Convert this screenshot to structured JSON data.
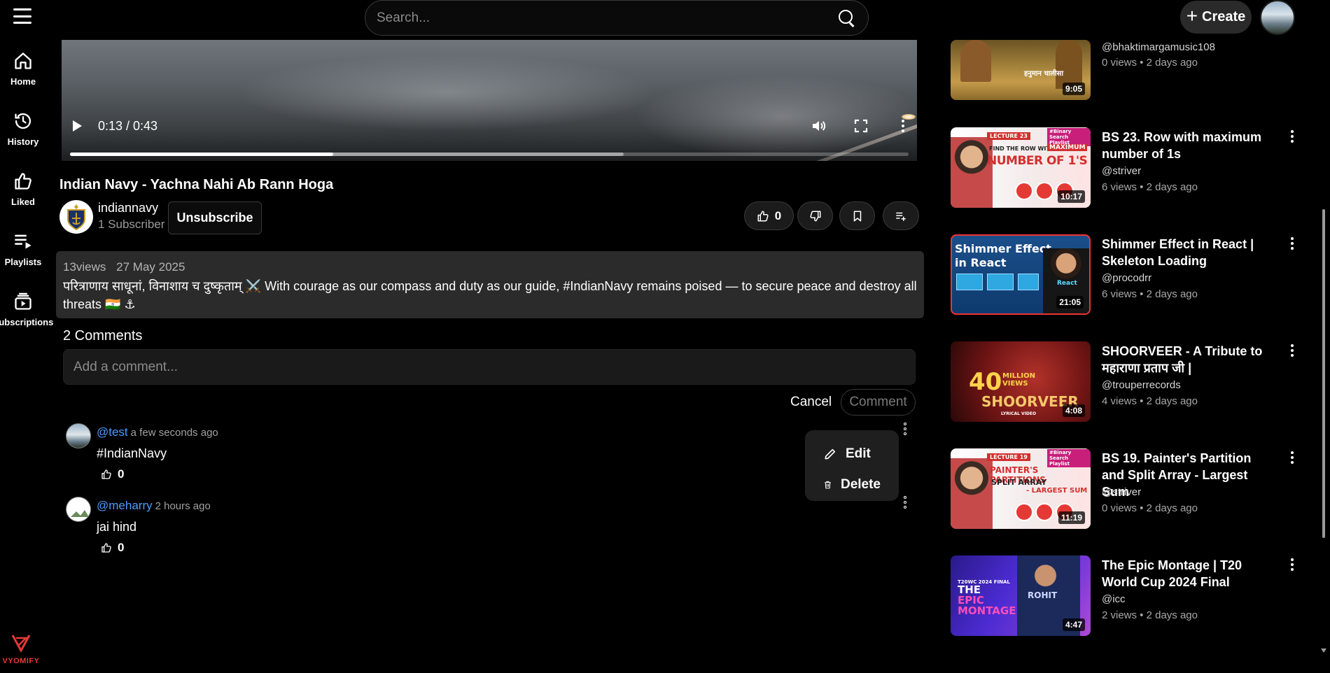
{
  "header": {
    "search_placeholder": "Search...",
    "create_label": "Create"
  },
  "sidebar": {
    "items": [
      {
        "label": "Home"
      },
      {
        "label": "History"
      },
      {
        "label": "Liked"
      },
      {
        "label": "Playlists"
      },
      {
        "label": "Subscriptions"
      }
    ],
    "brand": "VYOMIFY"
  },
  "player": {
    "time": "0:13 / 0:43",
    "played_fraction": 0.314,
    "buffered_fraction": 0.66
  },
  "video": {
    "title": "Indian Navy - Yachna Nahi Ab Rann Hoga",
    "channel": "indiannavy",
    "subscribers": "1 Subscriber",
    "unsubscribe_label": "Unsubscribe",
    "likes": "0",
    "views": "13views",
    "date": "27 May 2025",
    "description": "परित्राणाय साधूनां, विनाशाय च दुष्कृताम् ⚔️ With courage as our compass and duty as our guide, #IndianNavy remains poised — to secure peace and destroy all threats 🇮🇳 ⚓"
  },
  "comments": {
    "count_label": "2 Comments",
    "input_placeholder": "Add a comment...",
    "cancel_label": "Cancel",
    "submit_label": "Comment",
    "items": [
      {
        "user": "@test",
        "time": "a few seconds ago",
        "text": "#IndianNavy",
        "likes": "0"
      },
      {
        "user": "@meharry",
        "time": "2 hours ago",
        "text": "jai hind",
        "likes": "0"
      }
    ],
    "menu": {
      "edit_label": "Edit",
      "delete_label": "Delete"
    }
  },
  "related": [
    {
      "title": "",
      "channel": "@bhaktimargamusic108",
      "meta": "0 views • 2 days ago",
      "duration": "9:05"
    },
    {
      "title": "BS 23. Row with maximum number of 1s",
      "channel": "@striver",
      "meta": "6 views • 2 days ago",
      "duration": "10:17"
    },
    {
      "title": "Shimmer Effect in React | Skeleton Loading",
      "channel": "@procodrr",
      "meta": "6 views • 2 days ago",
      "duration": "21:05"
    },
    {
      "title": "SHOORVEER - A Tribute to महाराणा प्रताप जी |",
      "channel": "@trouperrecords",
      "meta": "4 views • 2 days ago",
      "duration": "4:08"
    },
    {
      "title": "BS 19. Painter's Partition and Split Array - Largest Sum",
      "channel": "@striver",
      "meta": "0 views • 2 days ago",
      "duration": "11:19"
    },
    {
      "title": "The Epic Montage | T20 World Cup 2024 Final",
      "channel": "@icc",
      "meta": "2 views • 2 days ago",
      "duration": "4:47"
    }
  ],
  "thumb_text": {
    "t1": "हनुमान चालीसा",
    "t2_lecture": "LECTURE 23",
    "t2_line1": "FIND THE ROW WITH",
    "t2_line2": "MAXIMUM",
    "t2_big": "NUMBER OF 1'S",
    "t2_tag": "#Binary Search Playlist",
    "t3_line1": "Shimmer Effect",
    "t3_line2": "in React",
    "t3_badge": "React",
    "t4_big": "40",
    "t4_small": "MILLION VIEWS",
    "t4_title": "SHOORVEER",
    "t4_sub": "LYRICAL VIDEO",
    "t5_lecture": "LECTURE 19",
    "t5_line1": "PAINTER'S PARTITIONS",
    "t5_line2": "SPLIT ARRAY",
    "t5_line3": "- LARGEST SUM",
    "t5_tag": "#Binary Search Playlist",
    "t6_line1": "THE",
    "t6_line2": "EPIC",
    "t6_line3": "MONTAGE",
    "t6_tag": "T20WC 2024 FINAL",
    "t6_name": "ROHIT"
  }
}
